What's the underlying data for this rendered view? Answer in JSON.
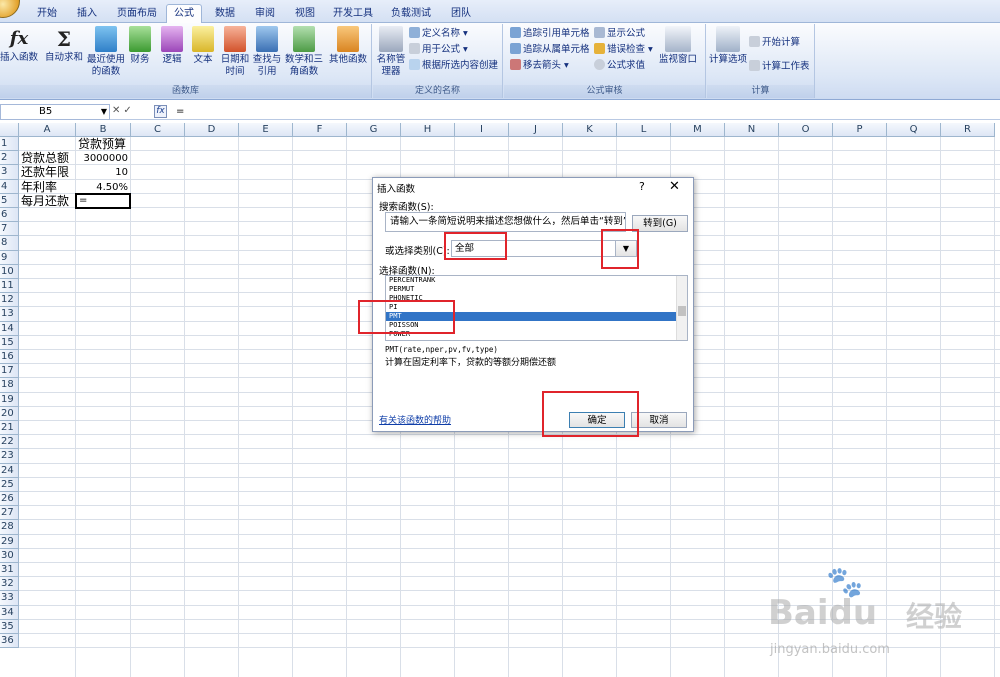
{
  "tabs": [
    "开始",
    "插入",
    "页面布局",
    "公式",
    "数据",
    "审阅",
    "视图",
    "开发工具",
    "负载测试",
    "团队"
  ],
  "active_tab": "公式",
  "ribbon": {
    "function_library": {
      "caption": "函数库",
      "buttons": [
        "插入函数",
        "自动求和",
        "最近使用的函数",
        "财务",
        "逻辑",
        "文本",
        "日期和时间",
        "查找与引用",
        "数学和三角函数",
        "其他函数"
      ]
    },
    "defined_names": {
      "caption": "定义的名称",
      "name_manager": "名称管理器",
      "items": [
        "定义名称",
        "用于公式",
        "根据所选内容创建"
      ]
    },
    "formula_auditing": {
      "caption": "公式审核",
      "items": [
        "追踪引用单元格",
        "追踪从属单元格",
        "移去箭头",
        "显示公式",
        "错误检查",
        "公式求值"
      ],
      "watch_window": "监视窗口"
    },
    "calculation": {
      "caption": "计算",
      "calc_options": "计算选项",
      "items": [
        "开始计算",
        "计算工作表"
      ]
    },
    "icon_colors": {
      "accent": "#15317e",
      "ribbon_bg": "#dde7f6"
    }
  },
  "formula_bar": {
    "name_box": "B5",
    "formula": "="
  },
  "sheet": {
    "columns": [
      "A",
      "B",
      "C",
      "D",
      "E",
      "F",
      "G",
      "H",
      "I",
      "J",
      "K",
      "L",
      "M",
      "N",
      "O",
      "P",
      "Q",
      "R"
    ],
    "rows": 36,
    "cells": {
      "B1": "贷款预算",
      "A2": "贷款总额",
      "B2": "3000000",
      "A3": "还款年限",
      "B3": "10",
      "A4": "年利率",
      "B4": "4.50%",
      "A5": "每月还款",
      "B5": "="
    },
    "active_cell": "B5"
  },
  "dialog": {
    "title": "插入函数",
    "help_glyph": "?",
    "close_glyph": "✕",
    "search_label": "搜索函数(S):",
    "search_value": "请输入一条简短说明来描述您想做什么，然后单击“转到”",
    "go_button": "转到(G)",
    "category_label": "或选择类别(C):",
    "category_value": "全部",
    "select_label": "选择函数(N):",
    "functions": [
      "PERCENTRANK",
      "PERMUT",
      "PHONETIC",
      "PI",
      "PMT",
      "POISSON",
      "POWER"
    ],
    "selected_function": "PMT",
    "syntax": "PMT(rate,nper,pv,fv,type)",
    "description": "计算在固定利率下，贷款的等额分期偿还额",
    "help_link": "有关该函数的帮助",
    "ok_button": "确定",
    "cancel_button": "取消",
    "highlight_color": "#e0242b"
  },
  "watermark": {
    "brand": "Bai",
    "brand2": "du",
    "cn": "经验",
    "url": "jingyan.baidu.com"
  }
}
